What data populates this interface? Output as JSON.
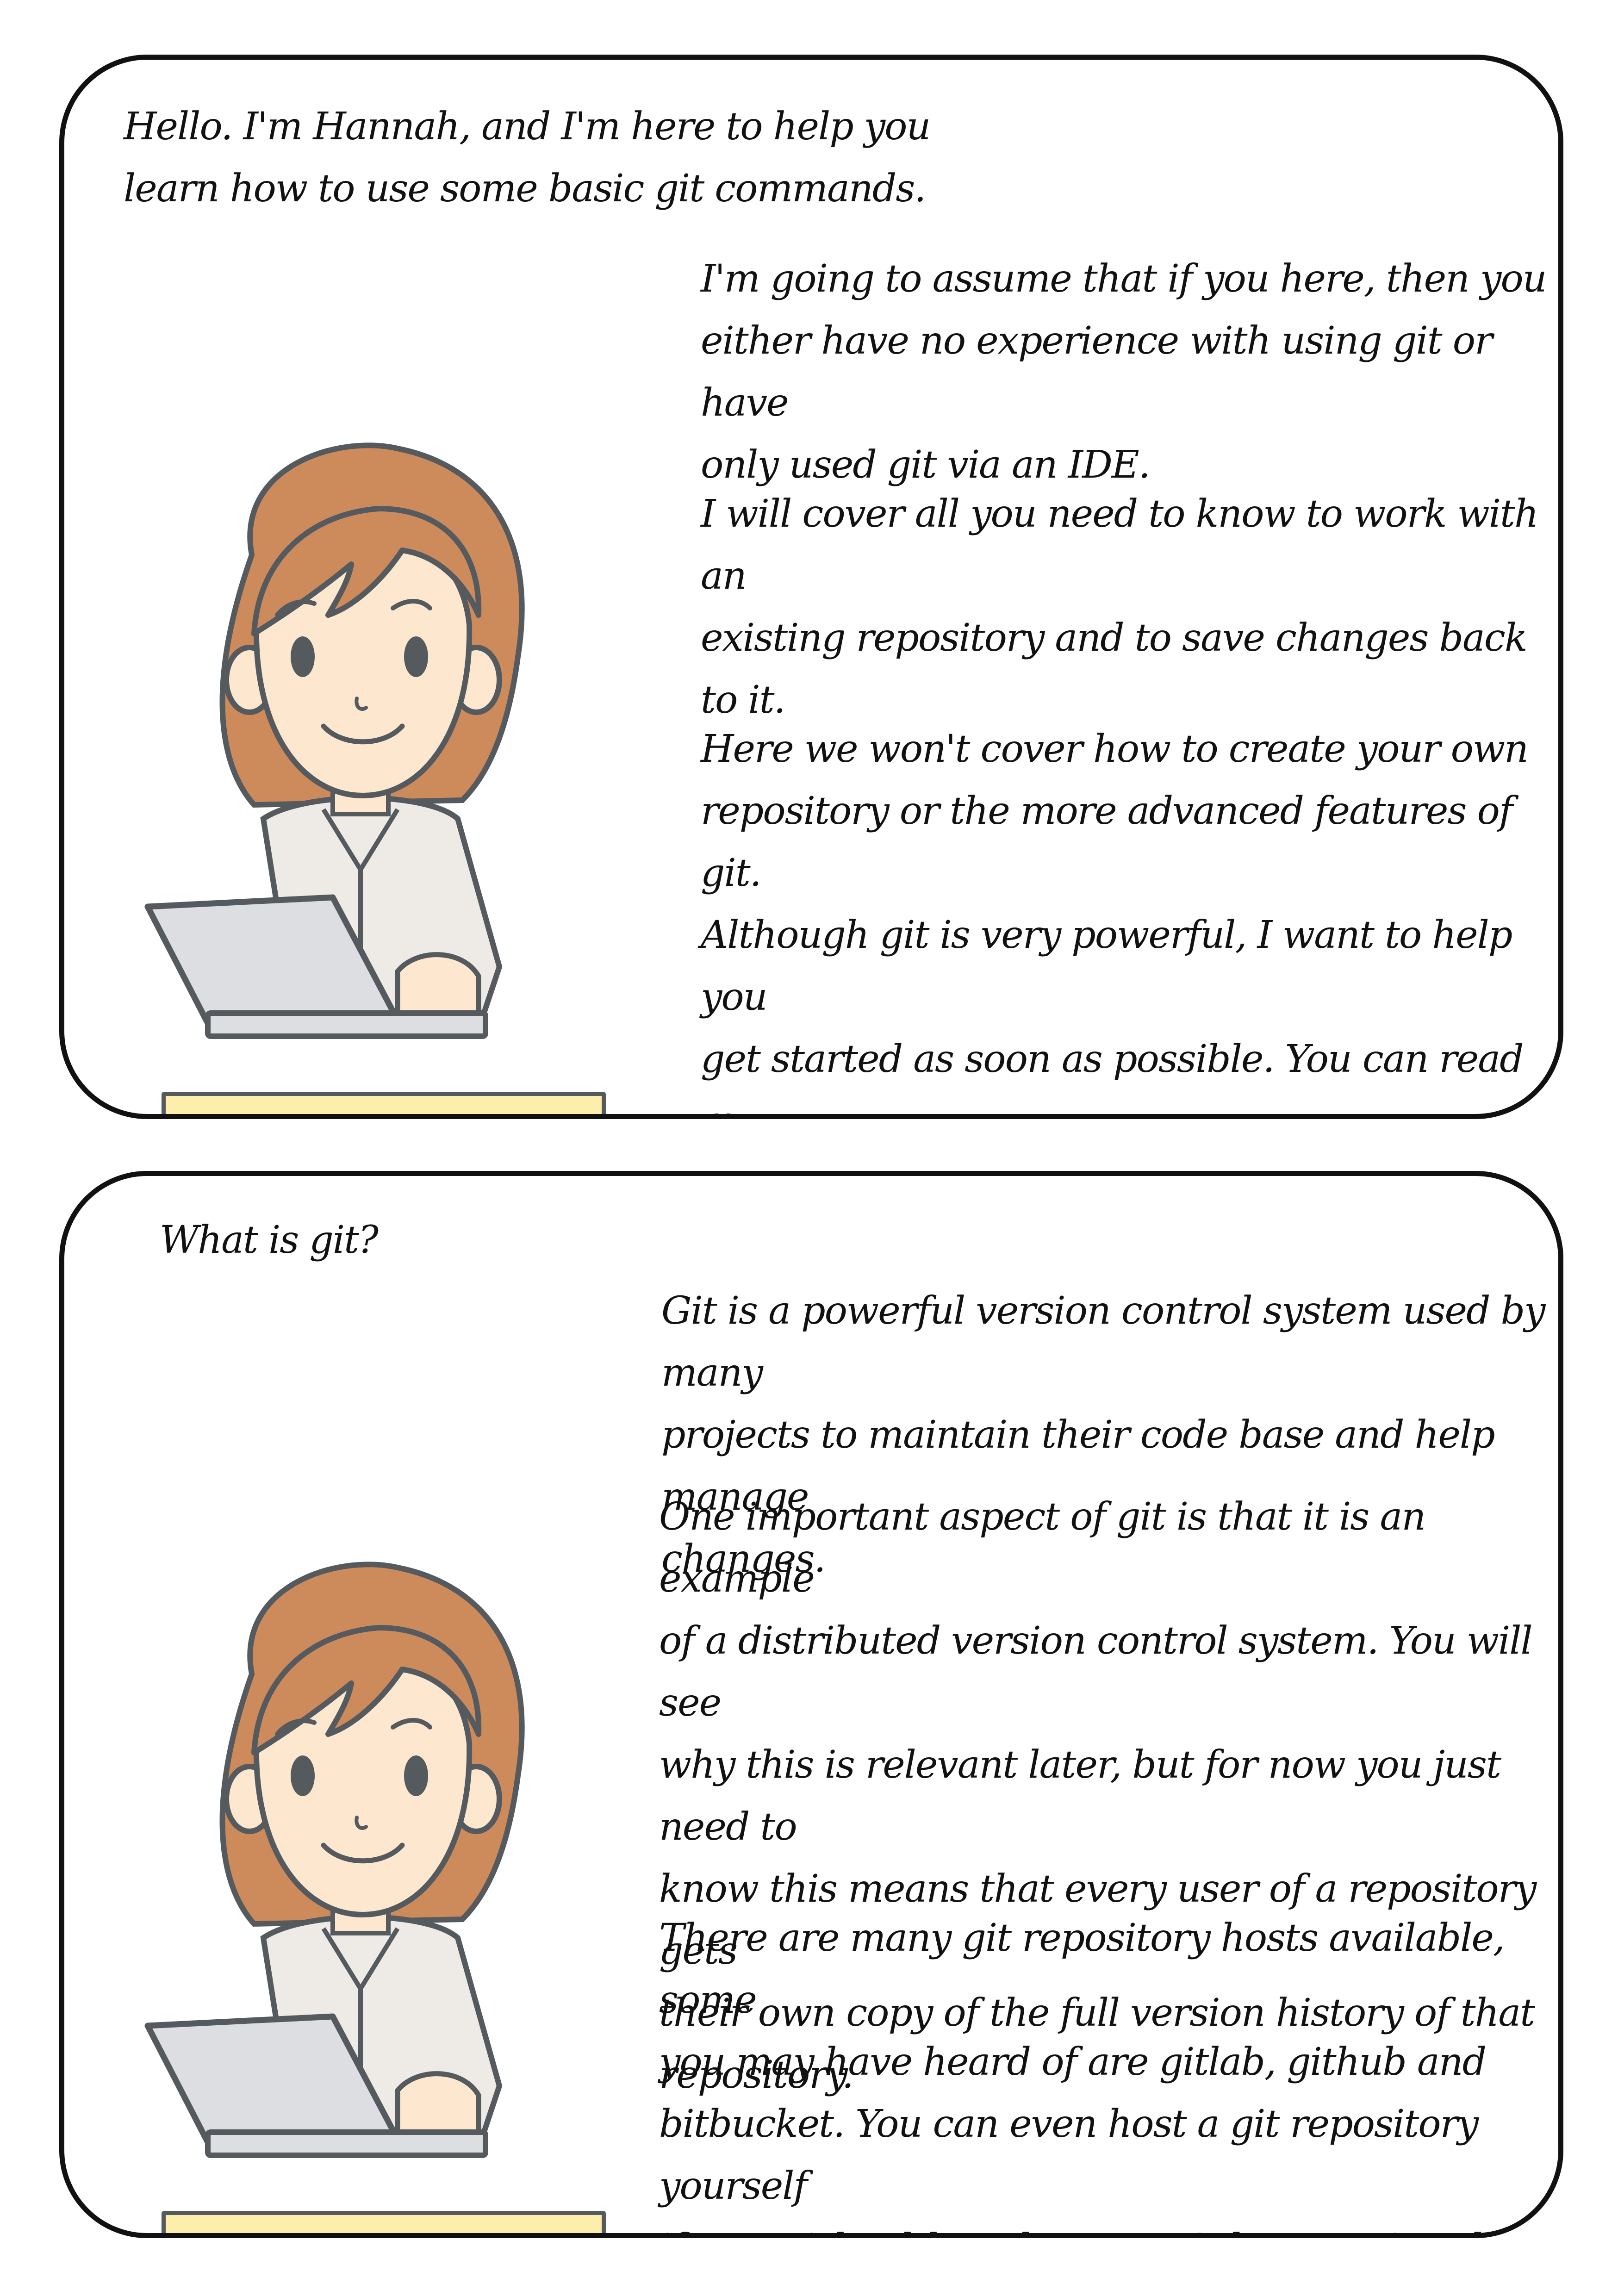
{
  "panels": [
    {
      "intro": "Hello. I'm Hannah, and I'm here to help you\nlearn how to use some basic git commands.",
      "paragraphs": [
        "I'm going to assume that if you here, then you\neither have no experience with using git or have\nonly used git via an IDE.",
        "I will cover all you need to know to work with an\nexisting repository and to save changes back to it.",
        "Here we won't cover how to create your own\nrepository or the more advanced features of git.\nAlthough git is very powerful, I want to help you\nget started as soon as possible. You can read my\nother guides on the more advanced features or do\nyour own research once you know the basics."
      ]
    },
    {
      "intro": "What is git?",
      "paragraphs": [
        "Git is a powerful version control system used by many\nprojects to maintain their code base and help manage\nchanges.",
        "One important aspect of git is that it is an example\nof a distributed version control system. You will see\nwhy this is relevant later, but for now you just need to\nknow this means that every user of a repository gets\ntheir own copy of the full version history of that\nrepository.",
        "There are many git repository hosts available, some\nyou may have heard of are gitlab, github and\nbitbucket. You can even host a git repository yourself\nif you wish, although we won't be covering that today."
      ]
    }
  ],
  "colors": {
    "hair": "#cd8a5b",
    "skin": "#fde8cf",
    "outline": "#555a5f",
    "laptop": "#dcdee2",
    "shirt": "#eeeae5",
    "desk": "#fdeeac",
    "border": "#111111"
  },
  "icons": {
    "character": "hannah-character-icon",
    "laptop": "laptop-icon"
  }
}
